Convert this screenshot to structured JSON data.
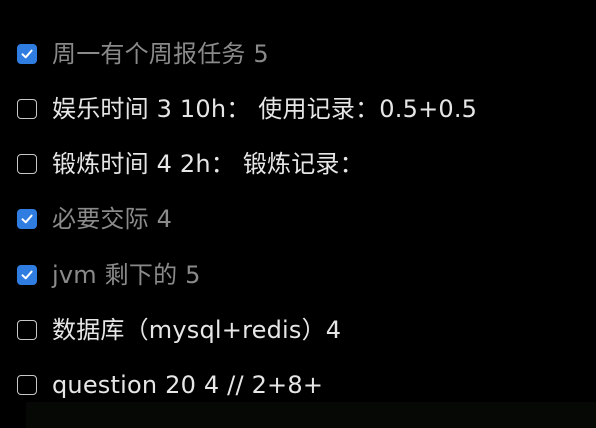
{
  "tasks": [
    {
      "text": "周一有个周报任务 5",
      "checked": true
    },
    {
      "text": "娱乐时间 3 10h： 使用记录：0.5+0.5",
      "checked": false
    },
    {
      "text": "锻炼时间 4 2h： 锻炼记录：",
      "checked": false
    },
    {
      "text": "必要交际 4",
      "checked": true
    },
    {
      "text": "jvm 剩下的 5",
      "checked": true
    },
    {
      "text": "数据库（mysql+redis）4",
      "checked": false
    },
    {
      "text": "question 20 4 // 2+8+",
      "checked": false
    }
  ],
  "colors": {
    "background": "#000000",
    "checkbox_checked": "#2f7de1",
    "checkbox_unchecked_border": "#c8c8c8",
    "text_done": "#8a8a8a",
    "text_todo": "#e6e6e6"
  },
  "icons": {
    "checked": "checkmark-icon"
  }
}
